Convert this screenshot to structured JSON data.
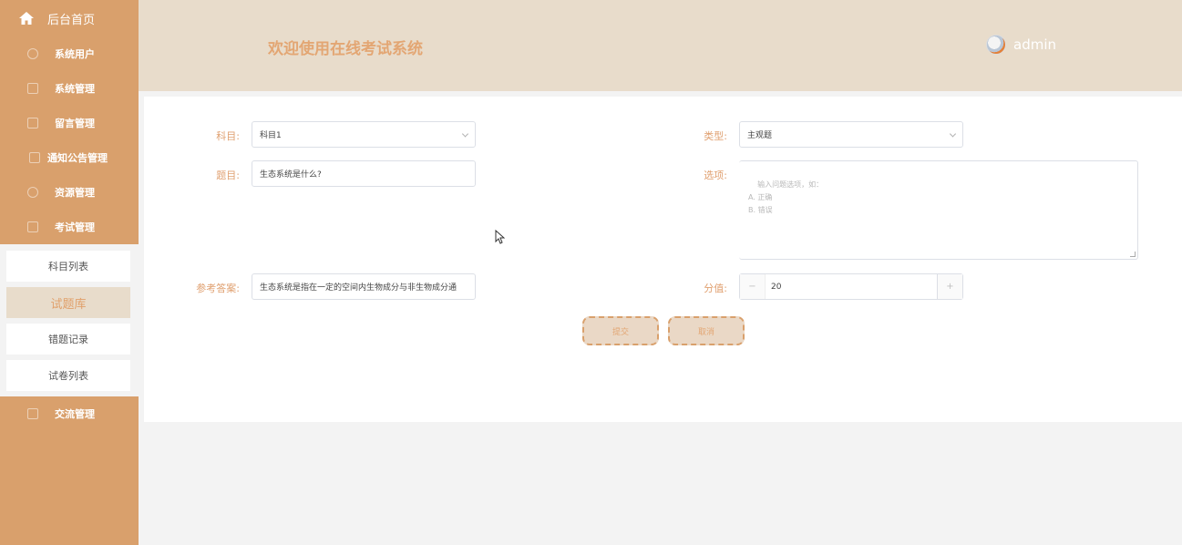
{
  "sidebar": {
    "home_label": "后台首页",
    "items": [
      {
        "label": "系统用户",
        "icon": "user-icon"
      },
      {
        "label": "系统管理",
        "icon": "edit-icon"
      },
      {
        "label": "留言管理",
        "icon": "message-icon"
      },
      {
        "label": "通知公告管理",
        "icon": "edit-icon"
      },
      {
        "label": "资源管理",
        "icon": "user-icon"
      },
      {
        "label": "考试管理",
        "icon": "exam-icon"
      }
    ],
    "submenu": [
      {
        "label": "科目列表"
      },
      {
        "label": "试题库"
      },
      {
        "label": "错题记录"
      },
      {
        "label": "试卷列表"
      }
    ],
    "after": {
      "label": "交流管理",
      "icon": "chat-icon"
    }
  },
  "header": {
    "title": "欢迎使用在线考试系统",
    "username": "admin"
  },
  "form": {
    "subject_label": "科目:",
    "subject_value": "科目1",
    "type_label": "类型:",
    "type_value": "主观题",
    "question_label": "题目:",
    "question_value": "生态系统是什么?",
    "options_label": "选项:",
    "options_placeholder": "输入问题选项，如：\nA. 正确\nB. 错误",
    "answer_label": "参考答案:",
    "answer_value": "生态系统是指在一定的空间内生物成分与非生物成分通",
    "score_label": "分值:",
    "score_value": "20",
    "score_minus": "−",
    "score_plus": "+",
    "submit_label": "提交",
    "cancel_label": "取消"
  },
  "colors": {
    "sidebar_bg": "#d9a06c",
    "header_bg": "#e8dccb",
    "accent": "#e3a673"
  }
}
